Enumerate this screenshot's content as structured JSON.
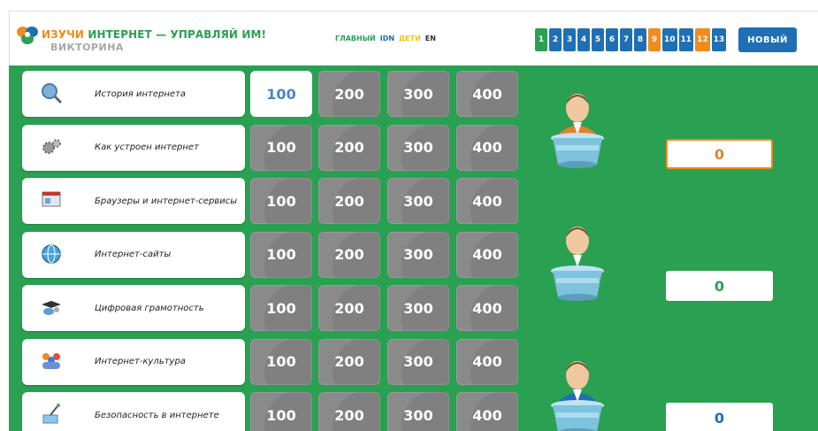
{
  "header": {
    "brand_part1": "ИЗУЧИ",
    "brand_part2": "ИНТЕРНЕТ — УПРАВЛЯЙ ИМ!",
    "subtitle": "ВИКТОРИНА",
    "logo_icon": "colorful-petals-logo-icon",
    "nav": {
      "main": "ГЛАВНЫЙ",
      "idn": "IDN",
      "kids": "ДЕТИ",
      "en": "EN"
    },
    "rounds": [
      {
        "label": "1",
        "color": "green"
      },
      {
        "label": "2",
        "color": "blue"
      },
      {
        "label": "3",
        "color": "blue"
      },
      {
        "label": "4",
        "color": "blue"
      },
      {
        "label": "5",
        "color": "blue"
      },
      {
        "label": "6",
        "color": "blue"
      },
      {
        "label": "7",
        "color": "blue"
      },
      {
        "label": "8",
        "color": "blue"
      },
      {
        "label": "9",
        "color": "orange"
      },
      {
        "label": "10",
        "color": "blue"
      },
      {
        "label": "11",
        "color": "blue"
      },
      {
        "label": "12",
        "color": "orange"
      },
      {
        "label": "13",
        "color": "blue"
      }
    ],
    "new_button": "НОВЫЙ"
  },
  "colors": {
    "board": "#2aa052",
    "tile": "#8a8a8a",
    "brand_orange": "#f08c1c",
    "brand_blue": "#1f6fb5",
    "open_tile_text": "#4a86c8"
  },
  "categories": [
    {
      "label": "История интернета",
      "icon": "magnifier-globe-icon"
    },
    {
      "label": "Как устроен интернет",
      "icon": "gears-icon"
    },
    {
      "label": "Браузеры и интернет-сервисы",
      "icon": "browser-window-icon"
    },
    {
      "label": "Интернет-сайты",
      "icon": "www-globe-icon"
    },
    {
      "label": "Цифровая грамотность",
      "icon": "graduation-mouse-icon"
    },
    {
      "label": "Интернет-культура",
      "icon": "people-group-icon"
    },
    {
      "label": "Безопасность в интернете",
      "icon": "satellite-icon"
    }
  ],
  "points": [
    "100",
    "200",
    "300",
    "400"
  ],
  "opened_tiles": [
    [
      0,
      0
    ]
  ],
  "players": [
    {
      "score": "0",
      "color": "#e0832a",
      "active": true,
      "icon": "player-orange-icon"
    },
    {
      "score": "0",
      "color": "#2aa052",
      "active": false,
      "icon": "player-green-icon"
    },
    {
      "score": "0",
      "color": "#1f6fb5",
      "active": false,
      "icon": "player-blue-icon"
    }
  ]
}
